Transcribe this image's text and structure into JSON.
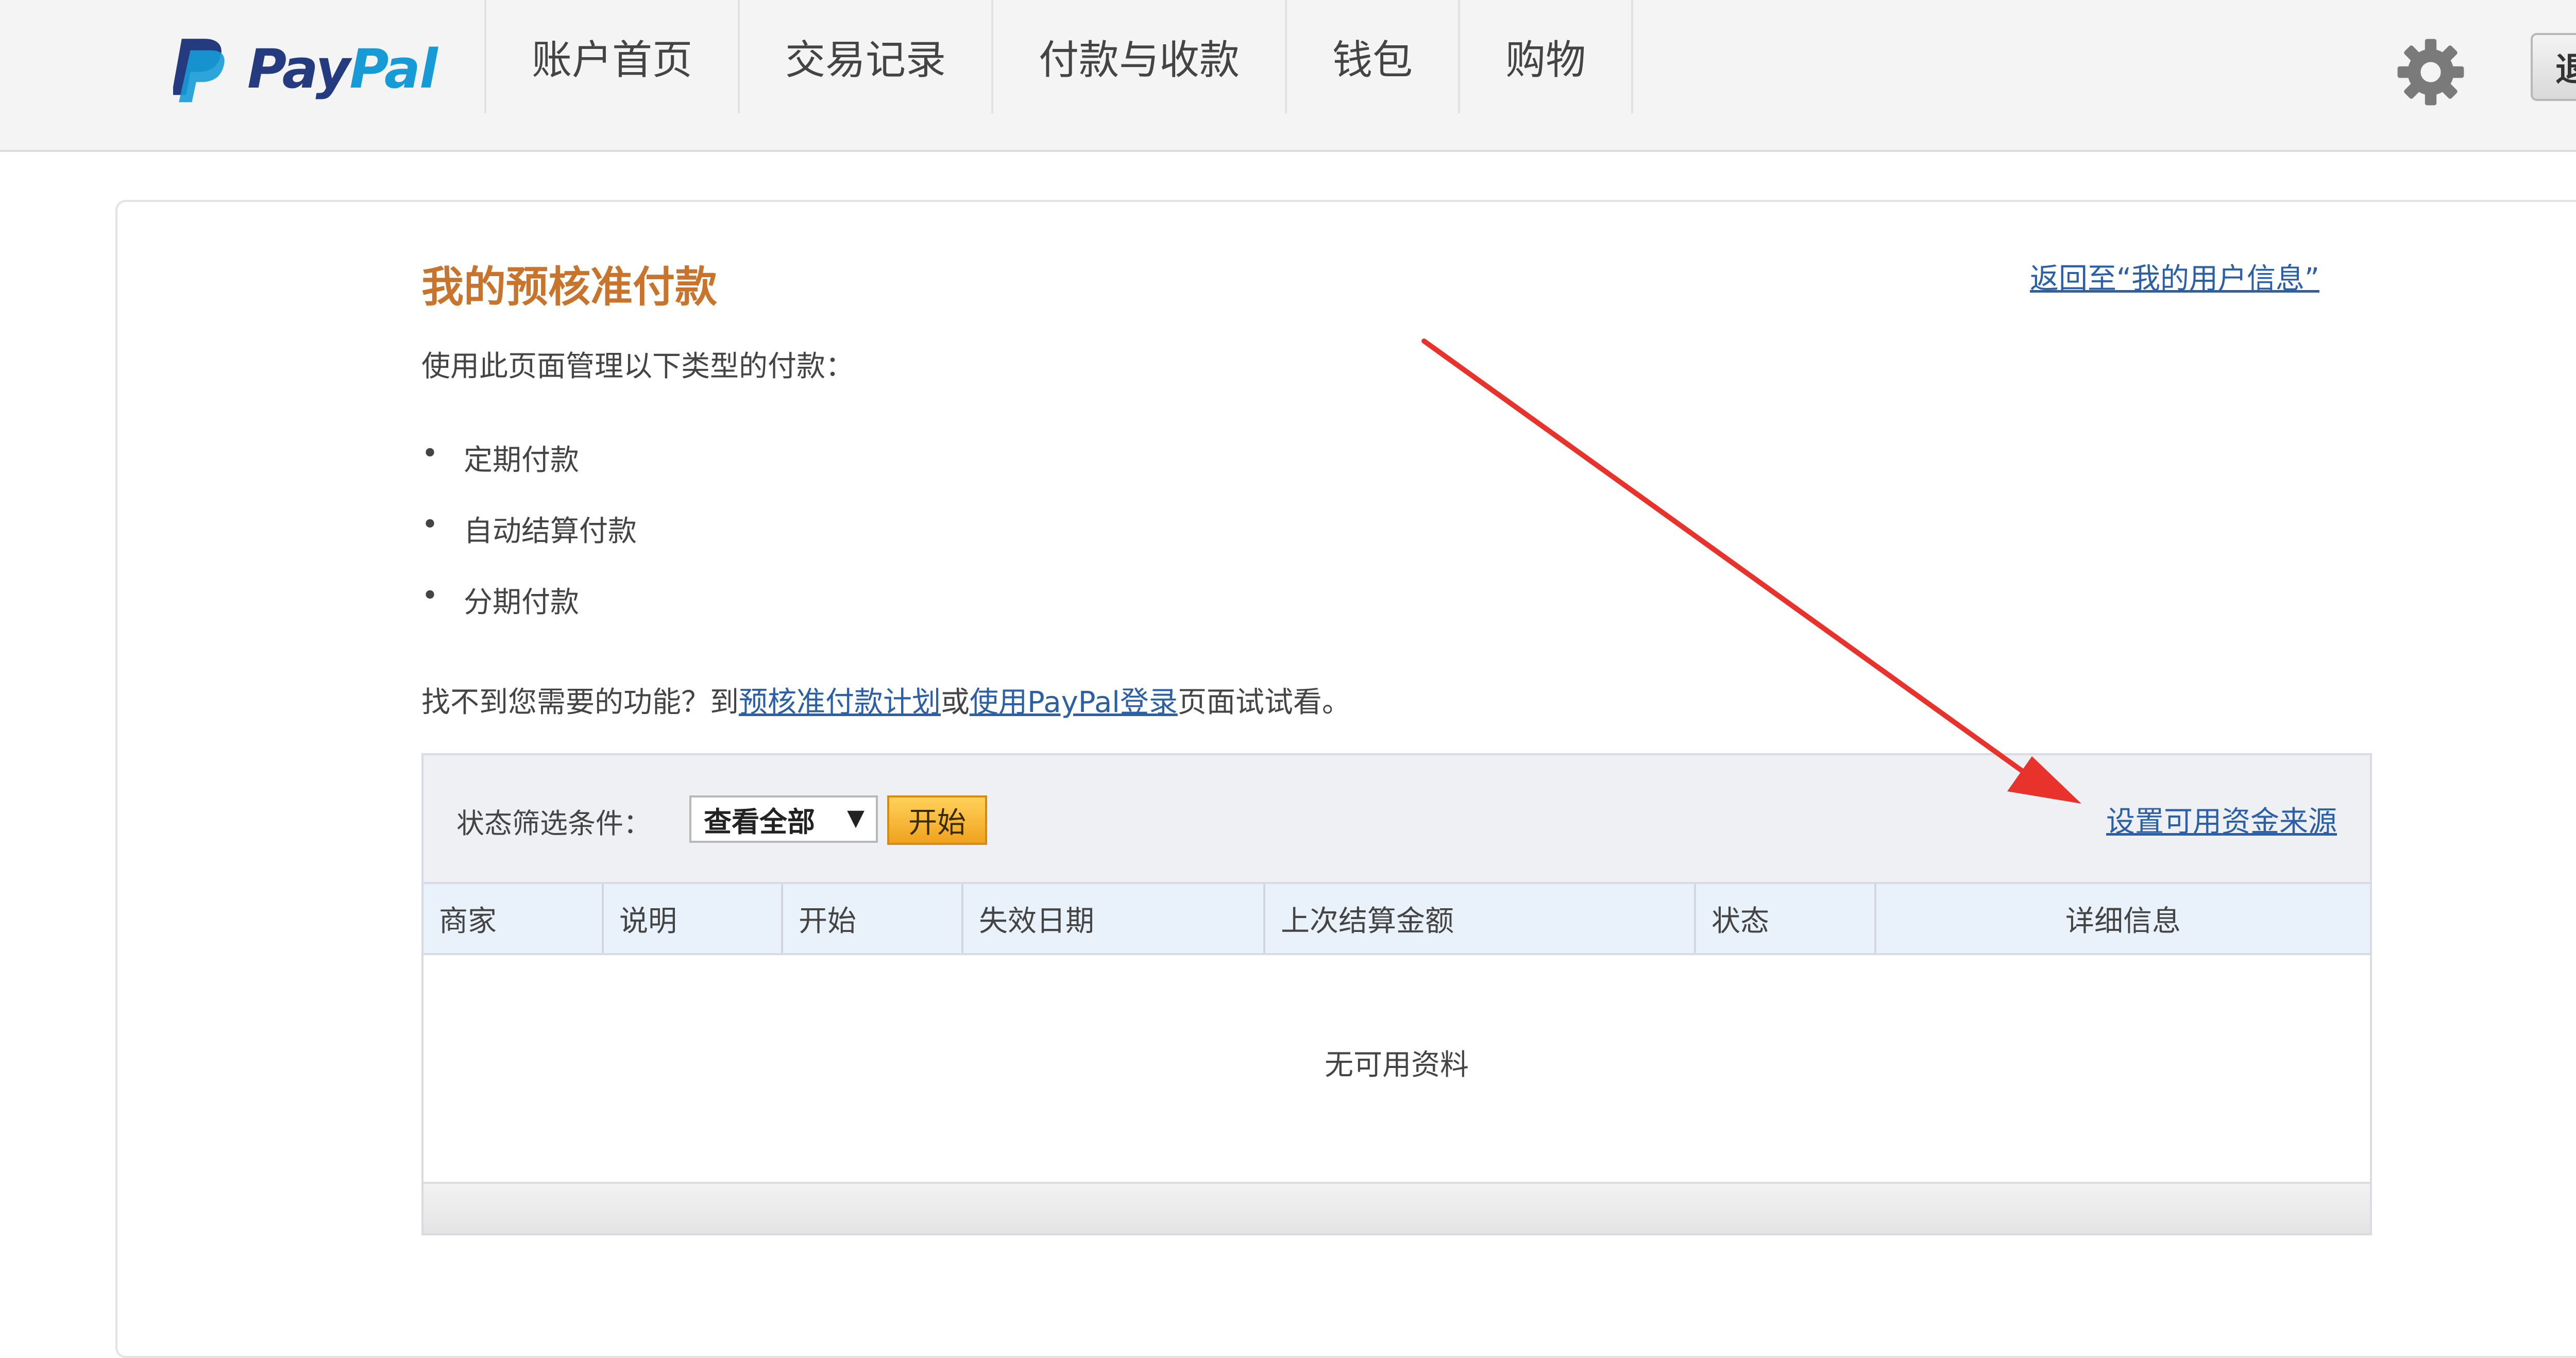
{
  "header": {
    "brand": {
      "pay": "Pay",
      "pal": "Pal"
    },
    "nav": [
      "账户首页",
      "交易记录",
      "付款与收款",
      "钱包",
      "购物"
    ],
    "logout_label": "退出",
    "icons": {
      "settings": "gear-icon",
      "logo": "paypal-logo-icon"
    }
  },
  "main": {
    "title": "我的预核准付款",
    "back_link": "返回至“我的用户信息”",
    "intro": "使用此页面管理以下类型的付款：",
    "bullets": [
      "定期付款",
      "自动结算付款",
      "分期付款"
    ],
    "notice": {
      "prefix": "找不到您需要的功能？到",
      "link1": "预核准付款计划",
      "middle": "或",
      "link2": "使用PayPal登录",
      "suffix": "页面试试看。"
    }
  },
  "filter": {
    "label": "状态筛选条件：",
    "selected": "查看全部",
    "start_button": "开始",
    "funding_link": "设置可用资金来源"
  },
  "table": {
    "columns": [
      "商家",
      "说明",
      "开始",
      "失效日期",
      "上次结算金额",
      "状态",
      "详细信息"
    ],
    "empty_message": "无可用资料"
  },
  "colors": {
    "title": "#c8742d",
    "link": "#2b5fa6",
    "brand_dark": "#253b80",
    "brand_light": "#179bd7",
    "annotation_arrow": "#e8322c"
  }
}
